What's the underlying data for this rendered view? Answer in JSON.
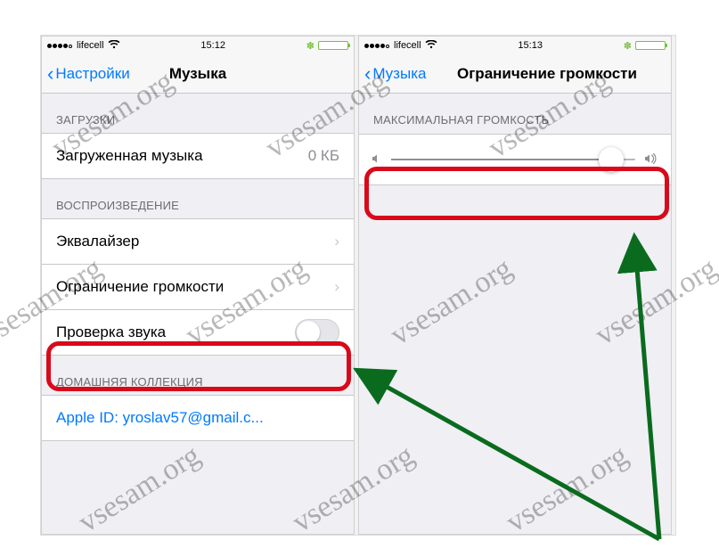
{
  "watermark": "vsesam.org",
  "left": {
    "status": {
      "carrier": "lifecell",
      "time": "15:12"
    },
    "nav": {
      "back": "Настройки",
      "title": "Музыка"
    },
    "sections": {
      "downloads_header": "ЗАГРУЗКИ",
      "downloaded_label": "Загруженная музыка",
      "downloaded_value": "0 КБ",
      "playback_header": "ВОСПРОИЗВЕДЕНИЕ",
      "equalizer": "Эквалайзер",
      "volume_limit": "Ограничение громкости",
      "sound_check": "Проверка звука",
      "home_header": "ДОМАШНЯЯ КОЛЛЕКЦИЯ",
      "apple_id": "Apple ID: yroslav57@gmail.c..."
    }
  },
  "right": {
    "status": {
      "carrier": "lifecell",
      "time": "15:13"
    },
    "nav": {
      "back": "Музыка",
      "title": "Ограничение громкости"
    },
    "sections": {
      "max_header": "МАКСИМАЛЬНАЯ ГРОМКОСТЬ"
    }
  }
}
